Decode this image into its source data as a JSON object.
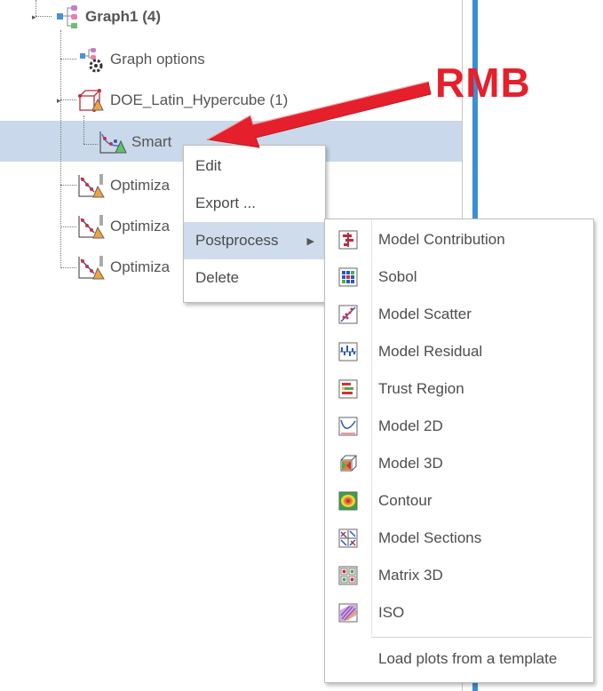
{
  "tree": {
    "root": {
      "label": "Graph1 (4)"
    },
    "graph_options": {
      "label": "Graph options"
    },
    "doe": {
      "label": "DOE_Latin_Hypercube (1)"
    },
    "smart": {
      "label": "Smart"
    },
    "optim1": {
      "label": "Optimiza"
    },
    "optim2": {
      "label": "Optimiza"
    },
    "optim3": {
      "label": "Optimiza"
    }
  },
  "context_menu": {
    "items": [
      {
        "label": "Edit"
      },
      {
        "label": "Export ..."
      },
      {
        "label": "Postprocess",
        "has_submenu": true,
        "active": true
      },
      {
        "label": "Delete"
      }
    ]
  },
  "submenu": {
    "items": [
      {
        "label": "Model Contribution",
        "icon": "model-contribution-icon"
      },
      {
        "label": "Sobol",
        "icon": "sobol-icon"
      },
      {
        "label": "Model Scatter",
        "icon": "model-scatter-icon"
      },
      {
        "label": "Model Residual",
        "icon": "model-residual-icon"
      },
      {
        "label": "Trust Region",
        "icon": "trust-region-icon"
      },
      {
        "label": "Model 2D",
        "icon": "model-2d-icon"
      },
      {
        "label": "Model 3D",
        "icon": "model-3d-icon"
      },
      {
        "label": "Contour",
        "icon": "contour-icon"
      },
      {
        "label": "Model Sections",
        "icon": "model-sections-icon"
      },
      {
        "label": "Matrix 3D",
        "icon": "matrix-3d-icon"
      },
      {
        "label": "ISO",
        "icon": "iso-icon"
      }
    ],
    "footer": {
      "label": "Load plots from a template"
    }
  },
  "annotation": {
    "label": "RMB",
    "color": "#e5202c"
  }
}
